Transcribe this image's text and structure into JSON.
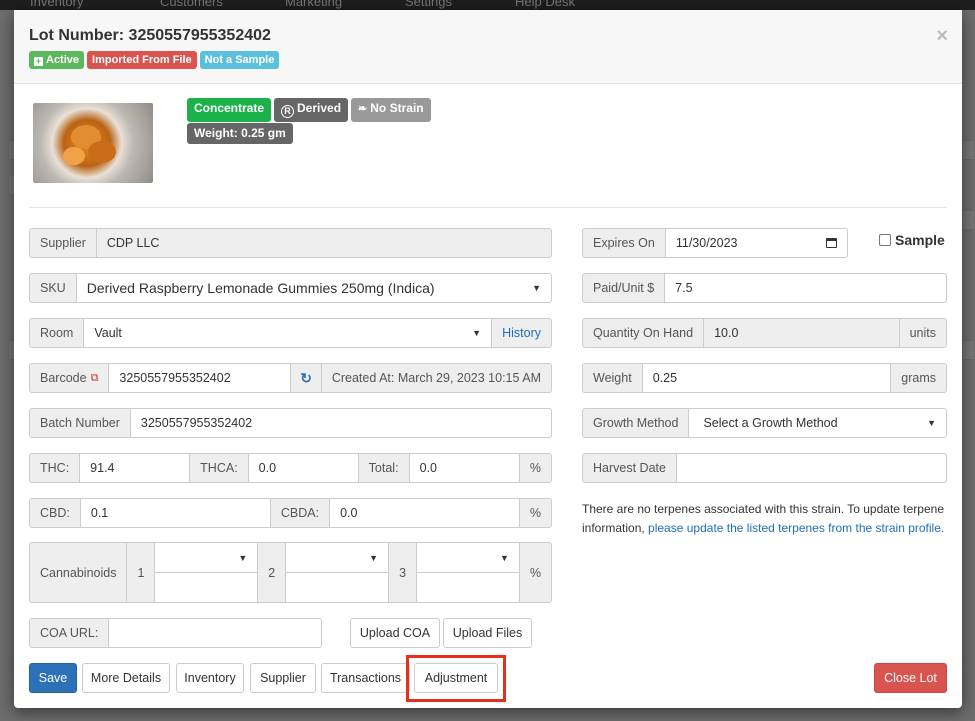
{
  "background_nav": {
    "items": [
      "Inventory",
      "Customers",
      "Marketing",
      "Settings",
      "Help Desk"
    ]
  },
  "modal": {
    "title": "Lot Number: 3250557955352402",
    "close_symbol": "×",
    "status_badges": [
      {
        "label": "Active",
        "icon": "plus-square-icon",
        "color": "#5cb85c"
      },
      {
        "label": "Imported From File",
        "color": "#d9534f"
      },
      {
        "label": "Not a Sample",
        "color": "#5bc0de"
      }
    ]
  },
  "product": {
    "image_alt": "concentrate-photo",
    "tags": {
      "category": "Concentrate",
      "type": "Derived",
      "type_icon": "registered-circle-icon",
      "strain": "No Strain",
      "strain_icon": "leaf-icon",
      "weight": "Weight: 0.25 gm"
    }
  },
  "left_form": {
    "supplier": {
      "label": "Supplier",
      "value": "CDP LLC"
    },
    "sku": {
      "label": "SKU",
      "value": "Derived Raspberry Lemonade Gummies 250mg (Indica)"
    },
    "room": {
      "label": "Room",
      "value": "Vault",
      "history_label": "History"
    },
    "barcode": {
      "label": "Barcode",
      "value": "3250557955352402",
      "created_at": "Created At: March 29, 2023 10:15 AM"
    },
    "batch": {
      "label": "Batch Number",
      "value": "3250557955352402"
    },
    "thc": {
      "label": "THC:",
      "value": "91.4",
      "thca_label": "THCA:",
      "thca_value": "0.0",
      "total_label": "Total:",
      "total_value": "0.0",
      "unit": "%"
    },
    "cbd": {
      "label": "CBD:",
      "value": "0.1",
      "cbda_label": "CBDA:",
      "cbda_value": "0.0",
      "unit": "%"
    },
    "cannabinoids": {
      "label": "Cannabinoids",
      "slots": [
        "1",
        "2",
        "3"
      ],
      "unit": "%"
    },
    "coa": {
      "label": "COA URL:",
      "value": "",
      "upload_coa": "Upload COA",
      "upload_files": "Upload Files"
    }
  },
  "right_form": {
    "expires": {
      "label": "Expires On",
      "value": "11/30/2023"
    },
    "sample_label": "Sample",
    "paid_unit": {
      "label": "Paid/Unit $",
      "value": "7.5"
    },
    "qty": {
      "label": "Quantity On Hand",
      "value": "10.0",
      "unit": "units"
    },
    "weight": {
      "label": "Weight",
      "value": "0.25",
      "unit": "grams"
    },
    "growth": {
      "label": "Growth Method",
      "value": "Select a Growth Method"
    },
    "harvest": {
      "label": "Harvest Date",
      "value": ""
    },
    "terpene_text": "There are no terpenes associated with this strain. To update terpene information,",
    "terpene_link": "please update the listed terpenes from the strain profile."
  },
  "footer": {
    "save": "Save",
    "more_details": "More Details",
    "inventory": "Inventory",
    "supplier": "Supplier",
    "transactions": "Transactions",
    "adjustment": "Adjustment",
    "close_lot": "Close Lot",
    "highlight_color": "#e5301a"
  },
  "colors": {
    "primary": "#2d72b8",
    "danger": "#d9534f",
    "success": "#1cb24a"
  }
}
